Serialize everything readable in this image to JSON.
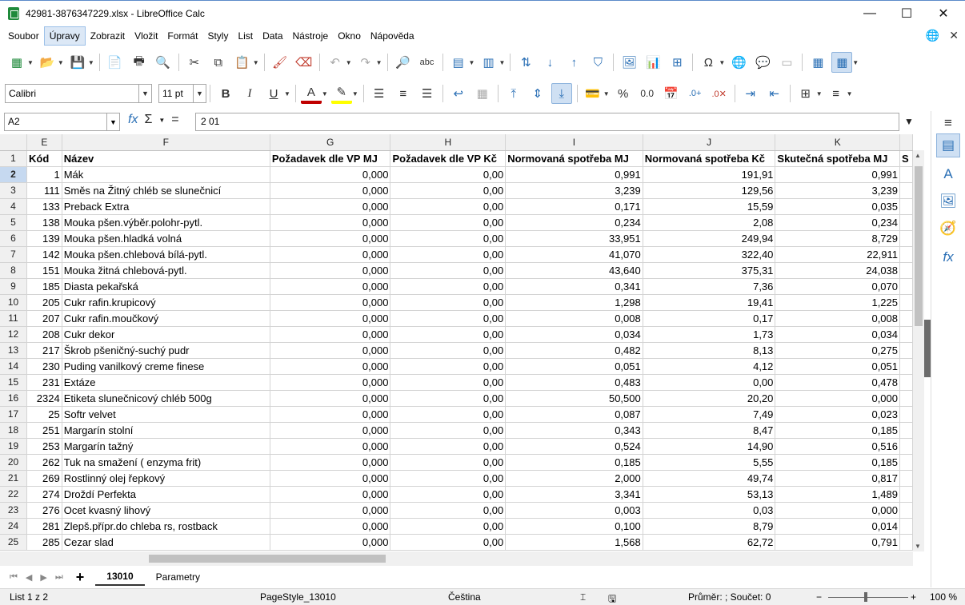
{
  "window": {
    "title": "42981-3876347229.xlsx - LibreOffice Calc",
    "minimize": "—",
    "maximize": "☐",
    "close": "✕"
  },
  "menu": [
    "Soubor",
    "Úpravy",
    "Zobrazit",
    "Vložit",
    "Formát",
    "Styly",
    "List",
    "Data",
    "Nástroje",
    "Okno",
    "Nápověda"
  ],
  "active_menu_index": 1,
  "font": {
    "name": "Calibri",
    "size": "11 pt"
  },
  "formula_bar": {
    "cell_ref": "A2",
    "content": "2 01"
  },
  "columns": [
    "E",
    "F",
    "G",
    "H",
    "I",
    "J",
    "K"
  ],
  "header_row": [
    "Kód",
    "Název",
    "Požadavek dle VP MJ",
    "Požadavek dle VP Kč",
    "Normovaná spotřeba MJ",
    "Normovaná spotřeba Kč",
    "Skutečná spotřeba MJ",
    "S"
  ],
  "rows": [
    {
      "n": "2",
      "cells": [
        "1",
        "Mák",
        "0,000",
        "0,00",
        "0,991",
        "191,91",
        "0,991"
      ]
    },
    {
      "n": "3",
      "cells": [
        "111",
        "Směs na Žitný chléb se slunečnicí",
        "0,000",
        "0,00",
        "3,239",
        "129,56",
        "3,239"
      ]
    },
    {
      "n": "4",
      "cells": [
        "133",
        "Preback Extra",
        "0,000",
        "0,00",
        "0,171",
        "15,59",
        "0,035"
      ]
    },
    {
      "n": "5",
      "cells": [
        "138",
        "Mouka pšen.výběr.polohr-pytl.",
        "0,000",
        "0,00",
        "0,234",
        "2,08",
        "0,234"
      ]
    },
    {
      "n": "6",
      "cells": [
        "139",
        "Mouka pšen.hladká volná",
        "0,000",
        "0,00",
        "33,951",
        "249,94",
        "8,729"
      ]
    },
    {
      "n": "7",
      "cells": [
        "142",
        "Mouka pšen.chlebová bílá-pytl.",
        "0,000",
        "0,00",
        "41,070",
        "322,40",
        "22,911"
      ]
    },
    {
      "n": "8",
      "cells": [
        "151",
        "Mouka žitná chlebová-pytl.",
        "0,000",
        "0,00",
        "43,640",
        "375,31",
        "24,038"
      ]
    },
    {
      "n": "9",
      "cells": [
        "185",
        "Diasta pekařská",
        "0,000",
        "0,00",
        "0,341",
        "7,36",
        "0,070"
      ]
    },
    {
      "n": "10",
      "cells": [
        "205",
        "Cukr rafin.krupicový",
        "0,000",
        "0,00",
        "1,298",
        "19,41",
        "1,225"
      ]
    },
    {
      "n": "11",
      "cells": [
        "207",
        "Cukr rafin.moučkový",
        "0,000",
        "0,00",
        "0,008",
        "0,17",
        "0,008"
      ]
    },
    {
      "n": "12",
      "cells": [
        "208",
        "Cukr dekor",
        "0,000",
        "0,00",
        "0,034",
        "1,73",
        "0,034"
      ]
    },
    {
      "n": "13",
      "cells": [
        "217",
        "Škrob pšeničný-suchý pudr",
        "0,000",
        "0,00",
        "0,482",
        "8,13",
        "0,275"
      ]
    },
    {
      "n": "14",
      "cells": [
        "230",
        "Puding vanilkový creme finese",
        "0,000",
        "0,00",
        "0,051",
        "4,12",
        "0,051"
      ]
    },
    {
      "n": "15",
      "cells": [
        "231",
        "Extáze",
        "0,000",
        "0,00",
        "0,483",
        "0,00",
        "0,478"
      ]
    },
    {
      "n": "16",
      "cells": [
        "2324",
        "Etiketa slunečnicový chléb 500g",
        "0,000",
        "0,00",
        "50,500",
        "20,20",
        "0,000"
      ]
    },
    {
      "n": "17",
      "cells": [
        "25",
        "Softr velvet",
        "0,000",
        "0,00",
        "0,087",
        "7,49",
        "0,023"
      ]
    },
    {
      "n": "18",
      "cells": [
        "251",
        "Margarín stolní",
        "0,000",
        "0,00",
        "0,343",
        "8,47",
        "0,185"
      ]
    },
    {
      "n": "19",
      "cells": [
        "253",
        "Margarín tažný",
        "0,000",
        "0,00",
        "0,524",
        "14,90",
        "0,516"
      ]
    },
    {
      "n": "20",
      "cells": [
        "262",
        "Tuk na smažení ( enzyma frit)",
        "0,000",
        "0,00",
        "0,185",
        "5,55",
        "0,185"
      ]
    },
    {
      "n": "21",
      "cells": [
        "269",
        "Rostlinný olej řepkový",
        "0,000",
        "0,00",
        "2,000",
        "49,74",
        "0,817"
      ]
    },
    {
      "n": "22",
      "cells": [
        "274",
        "Droždí Perfekta",
        "0,000",
        "0,00",
        "3,341",
        "53,13",
        "1,489"
      ]
    },
    {
      "n": "23",
      "cells": [
        "276",
        "Ocet kvasný lihový",
        "0,000",
        "0,00",
        "0,003",
        "0,03",
        "0,000"
      ]
    },
    {
      "n": "24",
      "cells": [
        "281",
        "Zlepš.přípr.do chleba rs, rostback",
        "0,000",
        "0,00",
        "0,100",
        "8,79",
        "0,014"
      ]
    },
    {
      "n": "25",
      "cells": [
        "285",
        "Cezar slad",
        "0,000",
        "0,00",
        "1,568",
        "62,72",
        "0,791"
      ]
    }
  ],
  "sheet_tabs": [
    "13010",
    "Parametry"
  ],
  "active_sheet": 0,
  "status": {
    "sheet_info": "List 1 z 2",
    "page_style": "PageStyle_13010",
    "language": "Čeština",
    "sum_info": "Průměr: ; Součet: 0",
    "zoom": "100 %",
    "zoom_level_percent": 100
  },
  "colors": {
    "selection": "#c6d9f0",
    "accent": "#2a6fb5"
  }
}
